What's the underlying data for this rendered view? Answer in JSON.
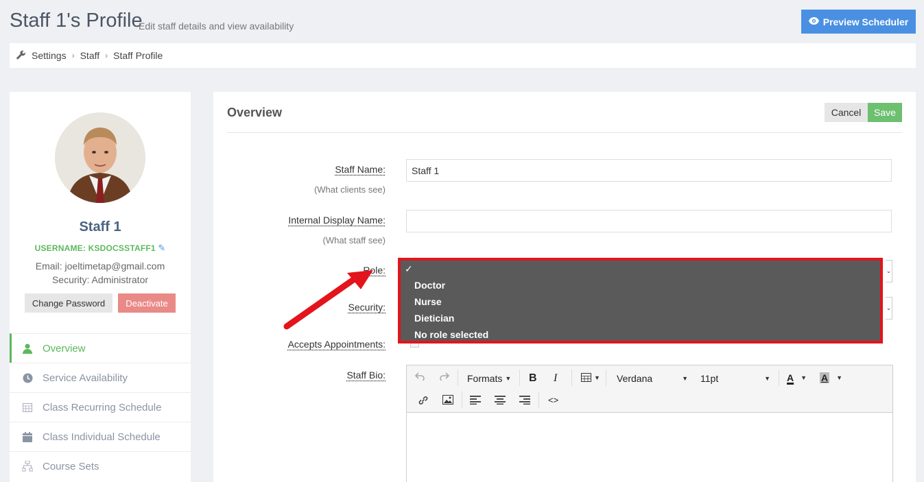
{
  "header": {
    "title": "Staff 1's Profile",
    "subtitle": "Edit staff details and view availability",
    "preview_button": "Preview Scheduler"
  },
  "breadcrumb": [
    "Settings",
    "Staff",
    "Staff Profile"
  ],
  "profile": {
    "name": "Staff 1",
    "username": "USERNAME: KSDOCSSTAFF1",
    "email": "Email: joeltimetap@gmail.com",
    "security": "Security: Administrator",
    "change_password": "Change Password",
    "deactivate": "Deactivate"
  },
  "nav": [
    {
      "label": "Overview",
      "icon": "user-icon",
      "active": true
    },
    {
      "label": "Service Availability",
      "icon": "clock-icon",
      "active": false
    },
    {
      "label": "Class Recurring Schedule",
      "icon": "calendar-grid-icon",
      "active": false
    },
    {
      "label": "Class Individual Schedule",
      "icon": "calendar-icon",
      "active": false
    },
    {
      "label": "Course Sets",
      "icon": "sitemap-icon",
      "active": false
    }
  ],
  "overview": {
    "title": "Overview",
    "cancel": "Cancel",
    "save": "Save"
  },
  "form": {
    "staff_name_label": "Staff Name:",
    "staff_name_hint": "(What clients see)",
    "staff_name_value": "Staff 1",
    "internal_name_label": "Internal Display Name:",
    "internal_name_hint": "(What staff see)",
    "internal_name_value": "",
    "role_label": "Role:",
    "security_label": "Security:",
    "accepts_label": "Accepts Appointments:",
    "bio_label": "Staff Bio:"
  },
  "role_dropdown": {
    "selected_mark": "✓",
    "options": [
      "Doctor",
      "Nurse",
      "Dietician",
      "No role selected"
    ]
  },
  "editor": {
    "formats": "Formats",
    "font": "Verdana",
    "size": "11pt"
  },
  "colors": {
    "accent_blue": "#4a90e2",
    "success_green": "#5cb85c",
    "danger_red": "#e98a87",
    "highlight_red": "#e3141b"
  }
}
